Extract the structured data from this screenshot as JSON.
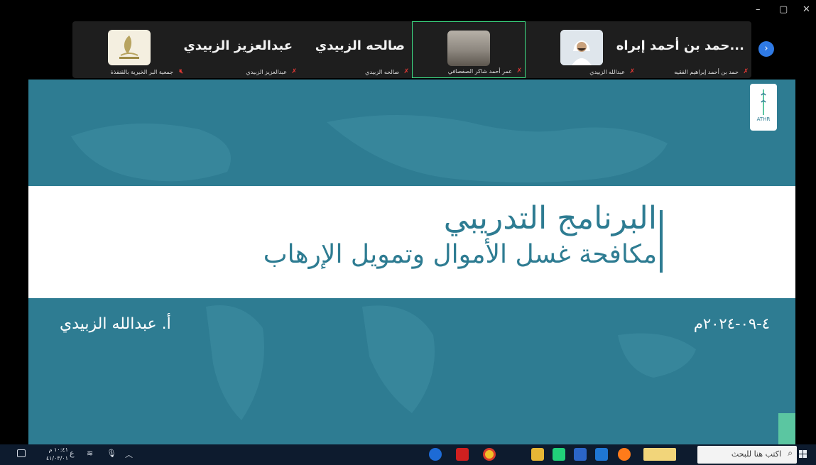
{
  "window": {
    "minimize": "–",
    "maximize": "▢",
    "close": "✕"
  },
  "participants": [
    {
      "big_name": "...حمد بن أحمد إبراه",
      "small_name": "حمد بن أحمد إبراهيم الفقيه",
      "type": "name"
    },
    {
      "big_name": "",
      "small_name": "عبدالله الزبيدي",
      "type": "photo"
    },
    {
      "big_name": "",
      "small_name": "عمر أحمد شاكر الصفصافي",
      "type": "video",
      "active": true
    },
    {
      "big_name": "صالحه الزبيدي",
      "small_name": "صالحه الزبيدي",
      "type": "name"
    },
    {
      "big_name": "عبدالعزيز الزبيدي",
      "small_name": "عبدالعزيز الزبيدي",
      "type": "name"
    },
    {
      "big_name": "",
      "small_name": "جمعية البر الخيرية بالقنفذة",
      "type": "logo"
    }
  ],
  "slide": {
    "title_line1": "البرنامج التدريبي",
    "title_line2": "مكافحة غسل الأموال وتمويل الإرهاب",
    "presenter": "أ. عبدالله الزبيدي",
    "date": "٤-٠٩-٢٠٢٤م",
    "logo_text": "ATHR",
    "colors": {
      "background": "#2e7c92",
      "band": "#ffffff",
      "accent": "#5bc6a1"
    }
  },
  "taskbar": {
    "search_placeholder": "اكتب هنا للبحث",
    "clock_time": "١٠:٤١ م",
    "clock_date": "٤١/٠٣/٠١",
    "lang": "ع",
    "apps": [
      "edge-icon",
      "acrobat-icon",
      "chrome-icon",
      "file-explorer-icon",
      "pycharm-icon",
      "store-icon",
      "mail-icon",
      "firefox-icon",
      "paint-icon"
    ]
  }
}
